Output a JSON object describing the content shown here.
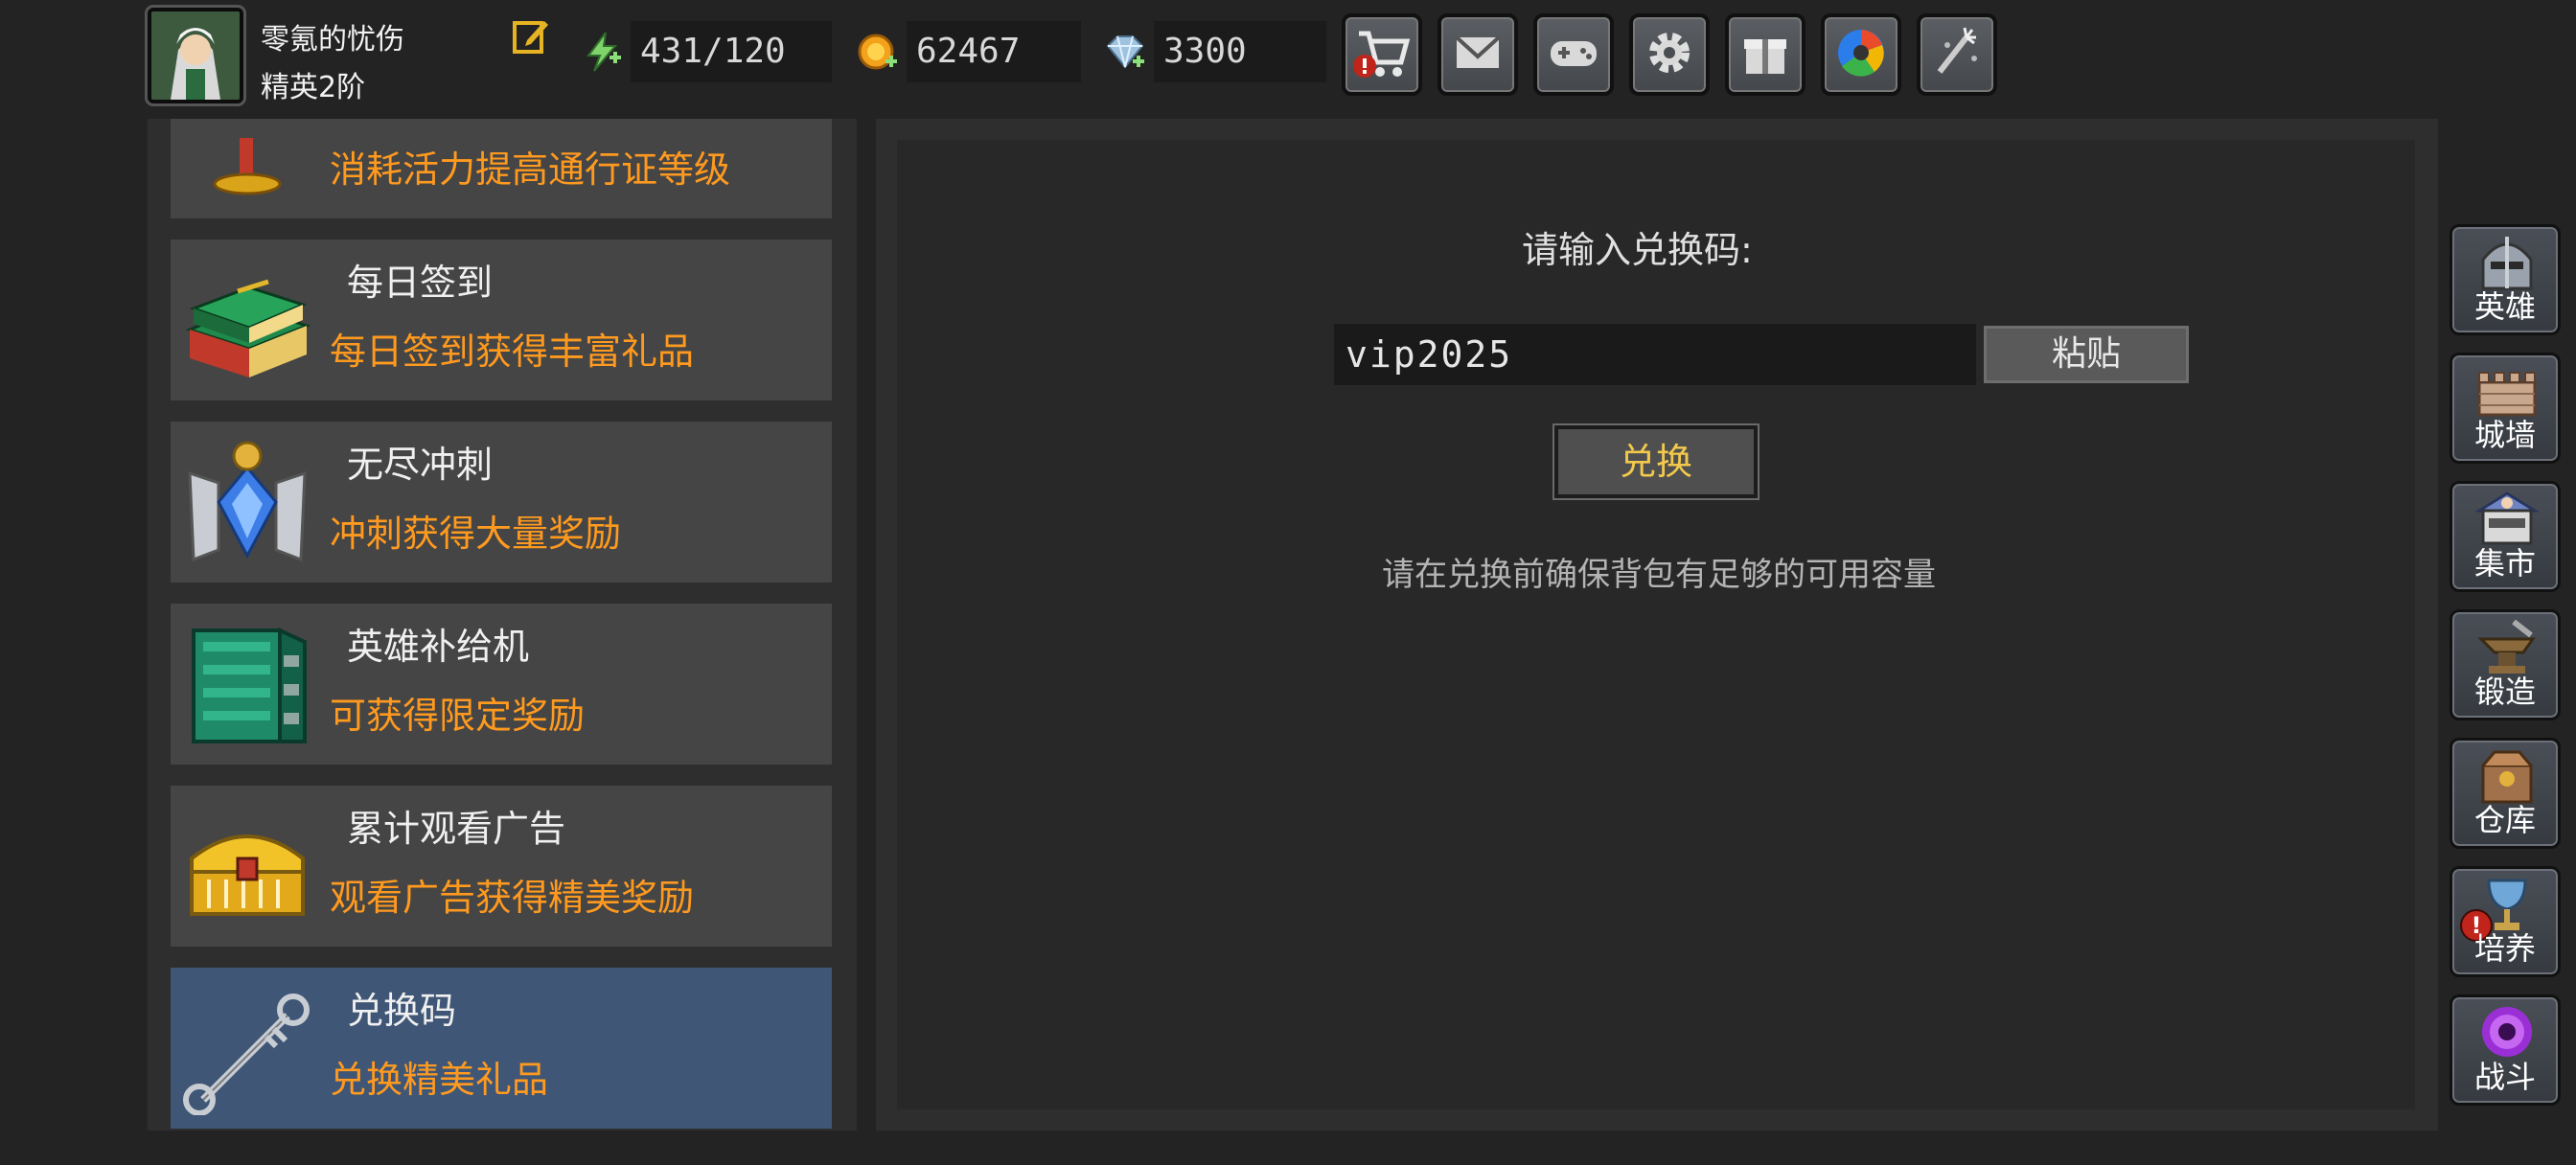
{
  "player": {
    "name": "零氪的忧伤",
    "rank": "精英2阶"
  },
  "resources": {
    "energy": "431/120",
    "gold": "62467",
    "gems": "3300"
  },
  "toolbar": [
    {
      "icon": "cart-icon",
      "alert": true
    },
    {
      "icon": "mail-icon",
      "alert": false
    },
    {
      "icon": "gamepad-icon",
      "alert": false
    },
    {
      "icon": "gear-icon",
      "alert": false
    },
    {
      "icon": "gift-icon",
      "alert": false
    },
    {
      "icon": "aperture-icon",
      "alert": false
    },
    {
      "icon": "fireworks-icon",
      "alert": false
    }
  ],
  "activities": [
    {
      "title": "",
      "desc": "消耗活力提高通行证等级",
      "icon": "trophy-icon"
    },
    {
      "title": "每日签到",
      "desc": "每日签到获得丰富礼品",
      "icon": "book-stack-icon"
    },
    {
      "title": "无尽冲刺",
      "desc": "冲刺获得大量奖励",
      "icon": "winged-crystal-icon"
    },
    {
      "title": "英雄补给机",
      "desc": "可获得限定奖励",
      "icon": "supply-machine-icon"
    },
    {
      "title": "累计观看广告",
      "desc": "观看广告获得精美奖励",
      "icon": "treasure-chest-icon"
    },
    {
      "title": "兑换码",
      "desc": "兑换精美礼品",
      "icon": "key-icon",
      "active": true
    }
  ],
  "redeem": {
    "prompt": "请输入兑换码:",
    "code": "vip2025",
    "paste_label": "粘贴",
    "redeem_label": "兑换",
    "tip": "请在兑换前确保背包有足够的可用容量"
  },
  "side_nav": [
    {
      "label": "英雄",
      "icon": "helmet-icon",
      "alert": false
    },
    {
      "label": "城墙",
      "icon": "wall-icon",
      "alert": false
    },
    {
      "label": "集市",
      "icon": "market-icon",
      "alert": false
    },
    {
      "label": "锻造",
      "icon": "anvil-icon",
      "alert": false
    },
    {
      "label": "仓库",
      "icon": "warehouse-icon",
      "alert": false
    },
    {
      "label": "培养",
      "icon": "chalice-icon",
      "alert": true
    },
    {
      "label": "战斗",
      "icon": "portal-icon",
      "alert": false
    }
  ],
  "colors": {
    "accent_orange": "#ff9a1f",
    "button_gold": "#f2c94c",
    "active_row": "#3f5676",
    "alert_red": "#c0241b"
  }
}
